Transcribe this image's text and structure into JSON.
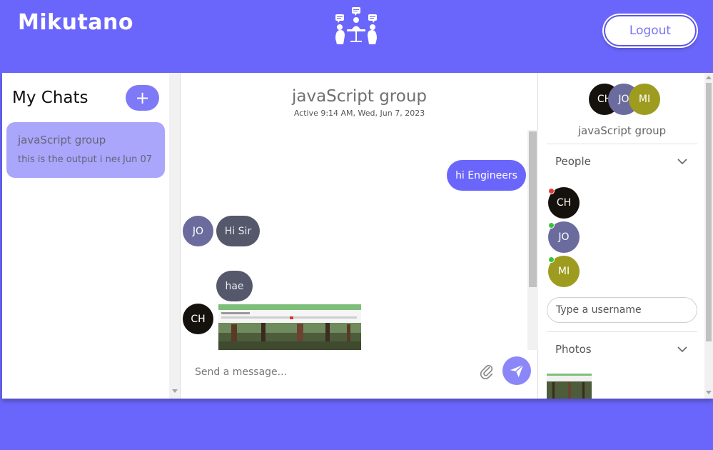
{
  "header": {
    "brand": "Mikutano",
    "logout_label": "Logout"
  },
  "left_panel": {
    "title": "My Chats",
    "add_label": "+",
    "chats": [
      {
        "name": "javaScript group",
        "preview": "this is the output i need",
        "date": "Jun 07"
      }
    ]
  },
  "conversation": {
    "title": "javaScript group",
    "subtitle": "Active 9:14 AM, Wed, Jun 7, 2023",
    "messages": [
      {
        "text": "hi Engineers",
        "direction": "outgoing"
      },
      {
        "sender_initials": "JO",
        "text": "Hi Sir",
        "direction": "incoming"
      },
      {
        "text": "hae",
        "direction": "incoming"
      },
      {
        "sender_initials": "CH",
        "direction": "incoming",
        "attachment": "image"
      }
    ],
    "composer_placeholder": "Send a message..."
  },
  "details_panel": {
    "group_name": "javaScript group",
    "group_avatars": [
      "CH",
      "JO",
      "MI"
    ],
    "people_title": "People",
    "people": [
      {
        "initials": "CH",
        "status": "offline"
      },
      {
        "initials": "JO",
        "status": "online"
      },
      {
        "initials": "MI",
        "status": "online"
      }
    ],
    "username_placeholder": "Type a username",
    "photos_title": "Photos"
  },
  "colors": {
    "brand": "#6b66fb",
    "avatar_ch": "#15120d",
    "avatar_jo": "#6b6b9e",
    "avatar_mi": "#9e9c1f",
    "online": "#3cc33c",
    "offline": "#e53935"
  }
}
